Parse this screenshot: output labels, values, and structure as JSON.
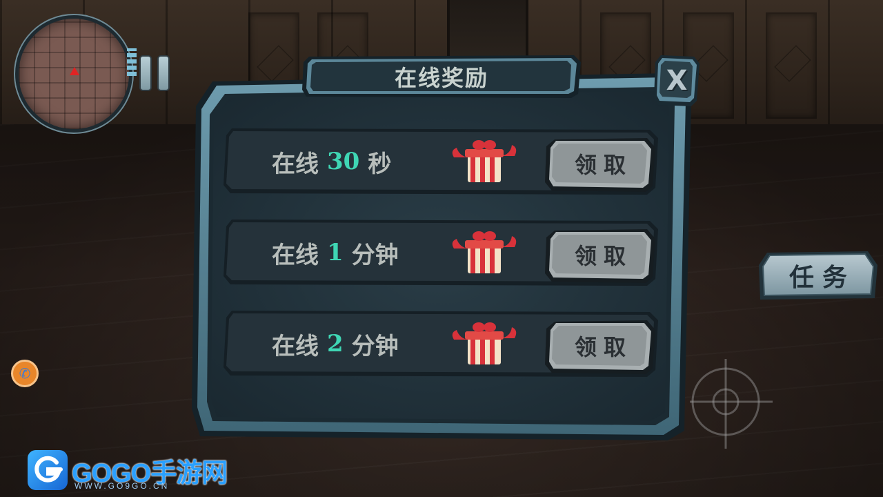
{
  "dialog": {
    "title": "在线奖励",
    "close_label": "X"
  },
  "rewards": [
    {
      "prefix": "在线",
      "amount": "30",
      "unit": "秒",
      "claim_label": "领取"
    },
    {
      "prefix": "在线",
      "amount": "1",
      "unit": "分钟",
      "claim_label": "领取"
    },
    {
      "prefix": "在线",
      "amount": "2",
      "unit": "分钟",
      "claim_label": "领取"
    }
  ],
  "hud": {
    "task_label": "任务"
  },
  "watermark": {
    "brand": "GOGO手游网",
    "url": "WWW.GO9GO.CN"
  },
  "colors": {
    "panel": "#1f2f38",
    "frame": "#4e7a8c",
    "accent_number": "#3fd6b4",
    "title_text": "#c9d3cf",
    "button_face": "#9fa6a8"
  },
  "icons": {
    "gift": "gift-box-icon",
    "close": "close-icon",
    "pause": "pause-icon",
    "crosshair": "crosshair-icon",
    "call": "phone-icon",
    "minimap_marker": "player-marker-icon"
  }
}
